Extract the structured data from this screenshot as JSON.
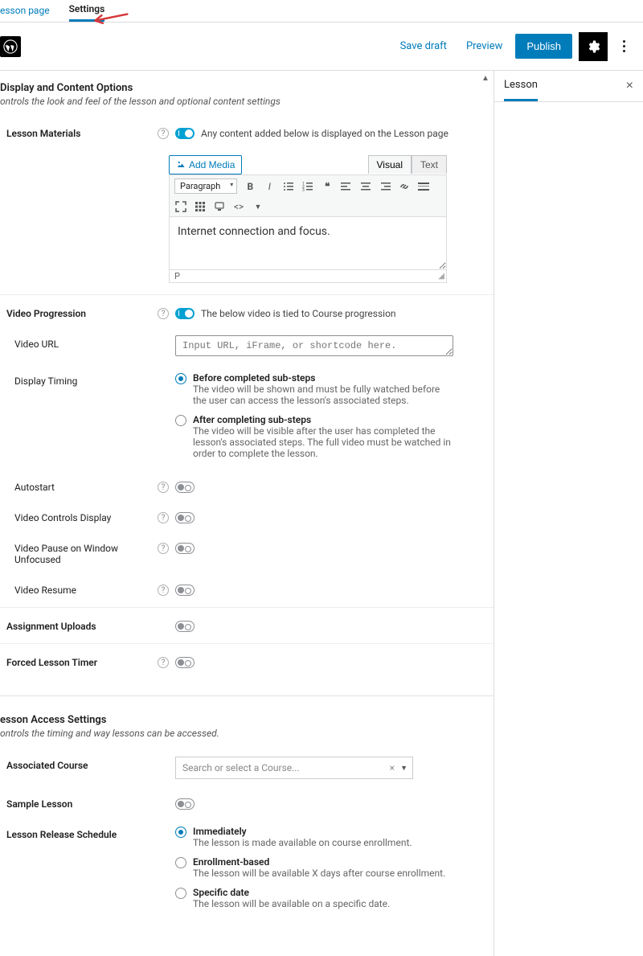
{
  "tabs": {
    "lesson_page": "esson page",
    "settings": "Settings"
  },
  "toolbar": {
    "save_draft": "Save draft",
    "preview": "Preview",
    "publish": "Publish"
  },
  "sidebar": {
    "tab_label": "Lesson"
  },
  "section1": {
    "title": "Display and Content Options",
    "subtitle": "ontrols the look and feel of the lesson and optional content settings"
  },
  "materials": {
    "label": "Lesson Materials",
    "toggle_desc": "Any content added below is displayed on the Lesson page",
    "add_media": "Add Media",
    "format": "Paragraph",
    "editor_tabs": {
      "visual": "Visual",
      "text": "Text"
    },
    "content": "Internet connection and focus.",
    "path": "P"
  },
  "video": {
    "label": "Video Progression",
    "toggle_desc": "The below video is tied to Course progression",
    "url_label": "Video URL",
    "url_placeholder": "Input URL, iFrame, or shortcode here.",
    "timing_label": "Display Timing",
    "opt1_title": "Before completed sub-steps",
    "opt1_desc": "The video will be shown and must be fully watched before the user can access the lesson's associated steps.",
    "opt2_title": "After completing sub-steps",
    "opt2_desc": "The video will be visible after the user has completed the lesson's associated steps. The full video must be watched in order to complete the lesson.",
    "autostart": "Autostart",
    "controls": "Video Controls Display",
    "pause": "Video Pause on Window Unfocused",
    "resume": "Video Resume"
  },
  "assignment": {
    "label": "Assignment Uploads"
  },
  "timer": {
    "label": "Forced Lesson Timer"
  },
  "section2": {
    "title": "esson Access Settings",
    "subtitle": "ontrols the timing and way lessons can be accessed."
  },
  "access": {
    "course_label": "Associated Course",
    "course_placeholder": "Search or select a Course...",
    "sample_label": "Sample Lesson",
    "schedule_label": "Lesson Release Schedule",
    "opt1_title": "Immediately",
    "opt1_desc": "The lesson is made available on course enrollment.",
    "opt2_title": "Enrollment-based",
    "opt2_desc": "The lesson will be available X days after course enrollment.",
    "opt3_title": "Specific date",
    "opt3_desc": "The lesson will be available on a specific date."
  }
}
